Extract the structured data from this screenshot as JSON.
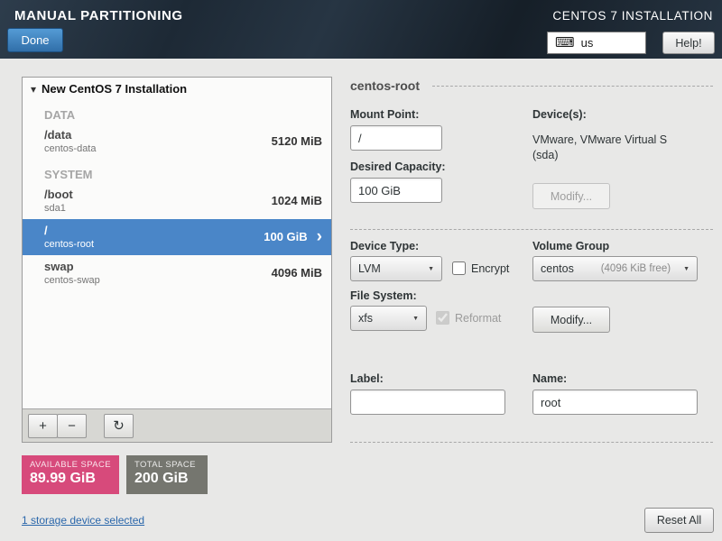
{
  "colors": {
    "header_bg": "#1d2935",
    "accent_blue": "#3d7fc2",
    "selection_blue": "#4a86c8",
    "available_pink": "#d74a7b",
    "total_gray": "#75766f",
    "link_blue": "#2b67ab"
  },
  "icons": {
    "expander": "▾",
    "keyboard": "⌨",
    "add": "+",
    "remove": "−",
    "refresh": "↻",
    "chevron_right": "›",
    "dropdown_arrow": "▼"
  },
  "header": {
    "title": "MANUAL PARTITIONING",
    "product": "CENTOS 7 INSTALLATION",
    "done_label": "Done",
    "keyboard_layout": "us",
    "help_label": "Help!"
  },
  "tree": {
    "root_label": "New CentOS 7 Installation",
    "sections": [
      {
        "name": "DATA"
      },
      {
        "name": "SYSTEM"
      }
    ],
    "rows": [
      {
        "mount": "/data",
        "device": "centos-data",
        "size": "5120 MiB"
      },
      {
        "mount": "/boot",
        "device": "sda1",
        "size": "1024 MiB"
      },
      {
        "mount": "/",
        "device": "centos-root",
        "size": "100 GiB"
      },
      {
        "mount": "swap",
        "device": "centos-swap",
        "size": "4096 MiB"
      }
    ]
  },
  "space": {
    "available_label": "AVAILABLE SPACE",
    "available_value": "89.99 GiB",
    "total_label": "TOTAL SPACE",
    "total_value": "200 GiB"
  },
  "footer": {
    "storage_link": "1 storage device selected",
    "reset_label": "Reset All"
  },
  "details": {
    "title": "centos-root",
    "mount_point_label": "Mount Point:",
    "mount_point_value": "/",
    "devices_label": "Device(s):",
    "devices_line1": "VMware, VMware Virtual S",
    "devices_line2": "(sda)",
    "desired_capacity_label": "Desired Capacity:",
    "desired_capacity_value": "100 GiB",
    "modify_device_label": "Modify...",
    "device_type_label": "Device Type:",
    "device_type_value": "LVM",
    "encrypt_label": "Encrypt",
    "volume_group_label": "Volume Group",
    "volume_group_value": "centos",
    "volume_group_free": "(4096 KiB free)",
    "file_system_label": "File System:",
    "file_system_value": "xfs",
    "reformat_label": "Reformat",
    "modify_vg_label": "Modify...",
    "label_label": "Label:",
    "label_value": "",
    "name_label": "Name:",
    "name_value": "root"
  }
}
